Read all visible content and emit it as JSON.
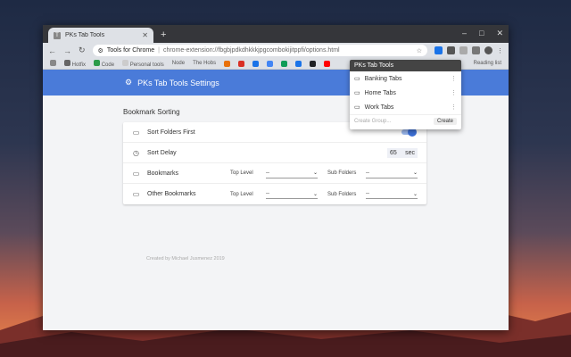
{
  "tab": {
    "title": "PKs Tab Tools",
    "favicon": "T"
  },
  "omnibox": {
    "site": "Tools for Chrome",
    "url": "chrome-extension://fbgbjpdkdhkkkjpgcombokijitppfi/options.html"
  },
  "bookmarks": [
    {
      "label": "",
      "color": "#888"
    },
    {
      "label": "Hotfix",
      "color": "#666"
    },
    {
      "label": "Code",
      "color": "#2d9c4a"
    },
    {
      "label": "Personal tools",
      "color": "#ccc"
    },
    {
      "label": "Node",
      "color": "#999"
    },
    {
      "label": "The Hobs",
      "color": "#999"
    }
  ],
  "bookmarks_right": "Reading list",
  "header": {
    "title": "PKs Tab Tools Settings"
  },
  "section": {
    "title": "Bookmark Sorting"
  },
  "settings": {
    "sort_folders_first": "Sort Folders First",
    "sort_delay": "Sort Delay",
    "delay_value": "65",
    "delay_unit": "sec",
    "bookmarks": "Bookmarks",
    "other_bookmarks": "Other Bookmarks",
    "top_level": "Top Level",
    "sub_folders": "Sub Folders",
    "select_value": "--"
  },
  "footer": "Created by Michael Jusmenez 2019",
  "popup": {
    "title": "PKs Tab Tools",
    "items": [
      "Banking Tabs",
      "Home Tabs",
      "Work Tabs"
    ],
    "placeholder": "Create Group...",
    "create": "Create"
  }
}
